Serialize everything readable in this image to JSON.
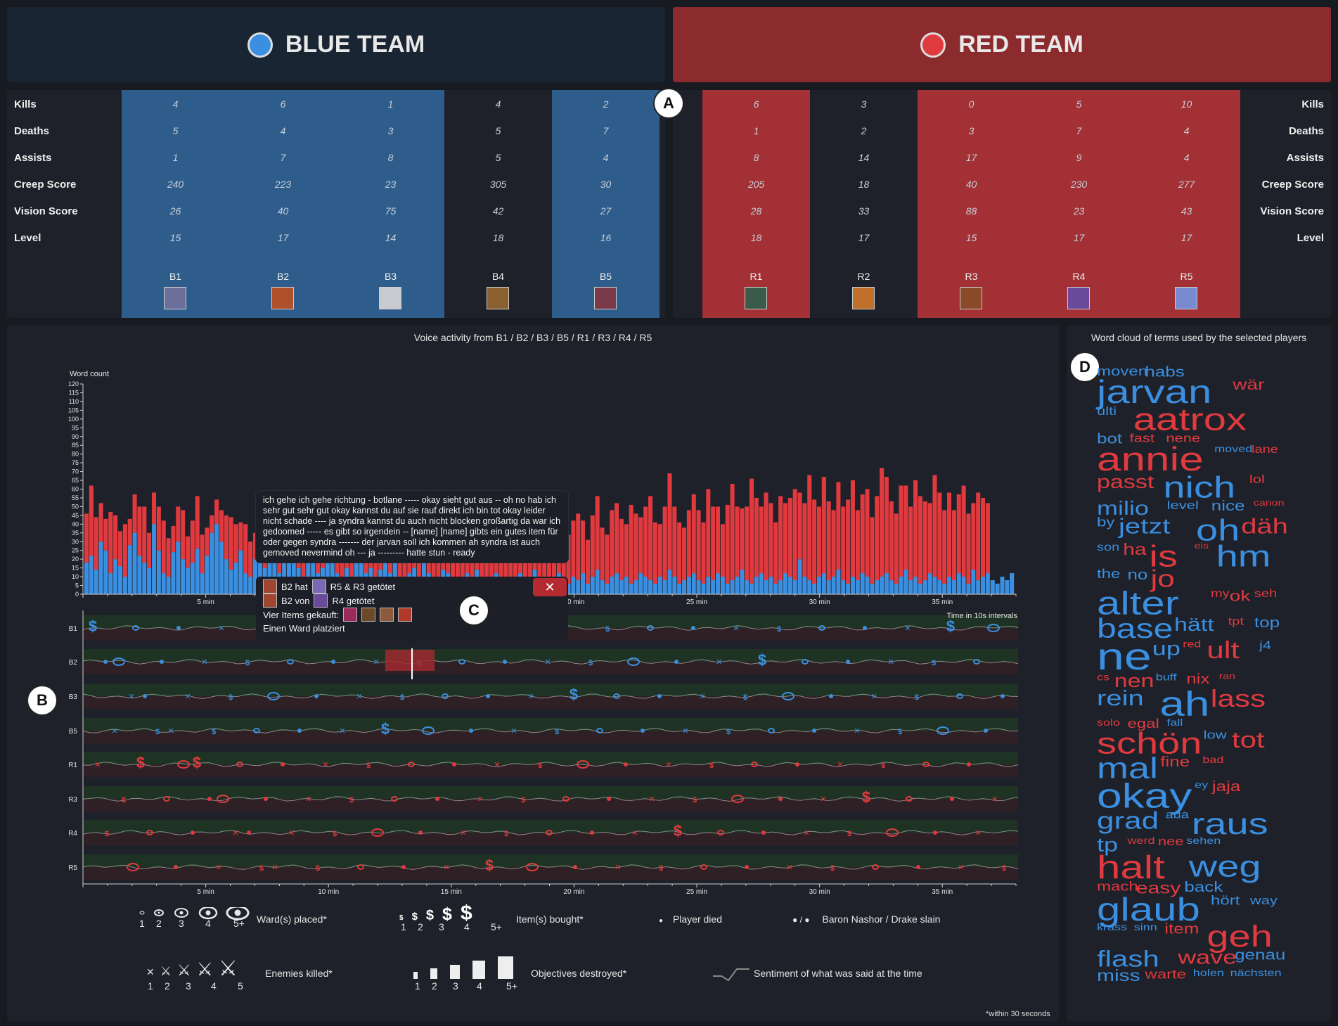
{
  "teams": {
    "blue": {
      "name": "BLUE TEAM",
      "color": "#3b8fe0"
    },
    "red": {
      "name": "RED TEAM",
      "color": "#e03a3f"
    }
  },
  "stat_labels": [
    "Kills",
    "Deaths",
    "Assists",
    "Creep Score",
    "Vision Score",
    "Level"
  ],
  "blue_players": [
    {
      "name": "B1",
      "selected": true,
      "stats": [
        "4",
        "5",
        "1",
        "240",
        "26",
        "15"
      ]
    },
    {
      "name": "B2",
      "selected": true,
      "stats": [
        "6",
        "4",
        "7",
        "223",
        "40",
        "17"
      ]
    },
    {
      "name": "B3",
      "selected": true,
      "stats": [
        "1",
        "3",
        "8",
        "23",
        "75",
        "14"
      ]
    },
    {
      "name": "B4",
      "selected": false,
      "stats": [
        "4",
        "5",
        "5",
        "305",
        "42",
        "18"
      ]
    },
    {
      "name": "B5",
      "selected": true,
      "stats": [
        "2",
        "7",
        "4",
        "30",
        "27",
        "16"
      ]
    }
  ],
  "red_players": [
    {
      "name": "R1",
      "selected": true,
      "stats": [
        "6",
        "1",
        "8",
        "205",
        "28",
        "18"
      ]
    },
    {
      "name": "R2",
      "selected": false,
      "stats": [
        "3",
        "2",
        "14",
        "18",
        "33",
        "17"
      ]
    },
    {
      "name": "R3",
      "selected": true,
      "stats": [
        "0",
        "3",
        "17",
        "40",
        "88",
        "15"
      ]
    },
    {
      "name": "R4",
      "selected": true,
      "stats": [
        "5",
        "7",
        "9",
        "230",
        "23",
        "17"
      ]
    },
    {
      "name": "R5",
      "selected": true,
      "stats": [
        "10",
        "4",
        "4",
        "277",
        "43",
        "17"
      ]
    }
  ],
  "markers": {
    "a": "A",
    "b": "B",
    "c": "C",
    "d": "D"
  },
  "voice": {
    "title": "Voice activity from B1 / B2 / B3 / B5 / R1 / R3 / R4 / R5",
    "ylabel": "Word count",
    "interval_label": "Time in 10s intervals",
    "x_ticks": [
      "5 min",
      "10 min",
      "15 min",
      "20 min",
      "25 min",
      "30 min",
      "35 min"
    ]
  },
  "chart_data": {
    "type": "bar",
    "title": "Voice activity from B1 / B2 / B3 / B5 / R1 / R3 / R4 / R5",
    "ylabel": "Word count",
    "xlabel": "Time in 10s intervals",
    "ylim": [
      0,
      120
    ],
    "y_ticks": [
      0,
      5,
      10,
      15,
      20,
      25,
      30,
      35,
      40,
      45,
      50,
      55,
      60,
      65,
      70,
      75,
      80,
      85,
      90,
      95,
      100,
      105,
      110,
      115,
      120
    ],
    "x_ticks": [
      "5 min",
      "10 min",
      "15 min",
      "20 min",
      "25 min",
      "30 min",
      "35 min"
    ],
    "series": [
      {
        "name": "blue",
        "values": [
          18,
          22,
          14,
          30,
          25,
          12,
          20,
          16,
          10,
          28,
          35,
          22,
          18,
          15,
          40,
          25,
          12,
          10,
          24,
          30,
          20,
          15,
          18,
          26,
          12,
          22,
          35,
          40,
          30,
          20,
          14,
          18,
          25,
          12,
          10,
          20,
          28,
          15,
          22,
          18,
          12,
          30,
          25,
          20,
          15,
          10,
          18,
          22,
          12,
          15,
          24,
          20,
          12,
          8,
          15,
          10,
          18,
          22,
          12,
          15,
          10,
          14,
          18,
          12,
          20,
          10,
          8,
          12,
          15,
          10,
          18,
          12,
          8,
          10,
          14,
          12,
          6,
          10,
          8,
          12,
          10,
          14,
          8,
          6,
          10,
          12,
          8,
          10,
          6,
          8,
          12,
          10,
          8,
          14,
          10,
          6,
          8,
          10,
          12,
          8,
          6,
          10,
          8,
          12,
          6,
          10,
          14,
          8,
          6,
          10,
          12,
          8,
          10,
          6,
          8,
          12,
          10,
          8,
          6,
          10,
          8,
          14,
          10,
          6,
          8,
          10,
          12,
          8,
          6,
          10,
          8,
          12,
          10,
          6,
          8,
          10,
          14,
          8,
          6,
          10,
          12,
          8,
          10,
          6,
          8,
          12,
          10,
          8,
          20,
          10,
          8,
          6,
          10,
          12,
          8,
          10,
          14,
          8,
          6,
          10,
          8,
          12,
          10,
          6,
          8,
          10,
          12,
          8,
          6,
          10,
          14,
          8,
          10,
          6,
          8,
          12,
          10,
          8,
          6,
          10,
          8,
          12,
          10,
          6,
          14,
          8,
          10,
          12,
          8,
          6,
          10,
          8,
          12
        ]
      },
      {
        "name": "red",
        "values": [
          28,
          40,
          30,
          22,
          18,
          35,
          25,
          20,
          30,
          15,
          22,
          28,
          32,
          20,
          18,
          25,
          30,
          22,
          15,
          20,
          28,
          18,
          24,
          30,
          22,
          16,
          10,
          14,
          18,
          25,
          30,
          22,
          16,
          28,
          20,
          15,
          22,
          18,
          26,
          14,
          20,
          25,
          18,
          12,
          30,
          22,
          16,
          20,
          25,
          18,
          12,
          20,
          28,
          16,
          22,
          18,
          35,
          25,
          15,
          20,
          40,
          28,
          22,
          30,
          18,
          25,
          32,
          20,
          15,
          28,
          22,
          30,
          35,
          25,
          20,
          30,
          40,
          28,
          22,
          35,
          45,
          30,
          25,
          38,
          28,
          22,
          30,
          40,
          35,
          28,
          25,
          30,
          38,
          42,
          30,
          28,
          35,
          40,
          30,
          25,
          28,
          32,
          38,
          30,
          25,
          35,
          42,
          30,
          28,
          38,
          40,
          35,
          30,
          45,
          38,
          32,
          40,
          48,
          35,
          30,
          42,
          55,
          40,
          35,
          30,
          38,
          45,
          40,
          35,
          50,
          42,
          38,
          30,
          45,
          55,
          40,
          35,
          42,
          60,
          45,
          38,
          50,
          42,
          35,
          48,
          40,
          45,
          52,
          38,
          42,
          60,
          48,
          40,
          55,
          45,
          38,
          50,
          42,
          48,
          55,
          40,
          45,
          50,
          38,
          48,
          62,
          55,
          45,
          40,
          52,
          48,
          42,
          55,
          50,
          45,
          40,
          58,
          50,
          42,
          48,
          40,
          45,
          52,
          40,
          38,
          50,
          45,
          40
        ]
      }
    ]
  },
  "timeline": {
    "rows": [
      {
        "name": "B1",
        "team": "blue"
      },
      {
        "name": "B2",
        "team": "blue"
      },
      {
        "name": "B3",
        "team": "blue"
      },
      {
        "name": "B5",
        "team": "blue"
      },
      {
        "name": "R1",
        "team": "red"
      },
      {
        "name": "R3",
        "team": "red"
      },
      {
        "name": "R4",
        "team": "red"
      },
      {
        "name": "R5",
        "team": "red"
      }
    ],
    "x_ticks": [
      "5 min",
      "10 min",
      "15 min",
      "20 min",
      "25 min",
      "30 min",
      "35 min"
    ]
  },
  "tooltip": {
    "transcript": "ich gehe ich gehe richtung - botlane ----- okay sieht gut aus -- oh no hab ich sehr gut sehr gut okay kannst du auf sie rauf direkt ich bin tot okay leider nicht schade ---- ja syndra kannst du auch nicht blocken großartig da war ich gedoomed ----- es gibt so irgendein -- [name] [name] gibts ein gutes item für oder gegen syndra ------- der jarvan soll ich kommen ah syndra ist auch gemoved nevermind oh --- ja --------- hatte stun - ready",
    "event1_a": "B2 hat",
    "event1_b": "R5 & R3 getötet",
    "event2_a": "B2 von",
    "event2_b": "R4 getötet",
    "event3": "Vier Items gekauft:",
    "event4": "Einen Ward platziert",
    "close": "✕"
  },
  "legend": {
    "wards": "Ward(s) placed*",
    "items": "Item(s) bought*",
    "died": "Player died",
    "baron": "Baron Nashor / Drake slain",
    "kills": "Enemies killed*",
    "objectives": "Objectives destroyed*",
    "sentiment": "Sentiment of what was said at the time",
    "counts": [
      "1",
      "2",
      "3",
      "4",
      "5+"
    ],
    "kill_counts": [
      "1",
      "2",
      "3",
      "4",
      "5"
    ],
    "footnote": "*within 30 seconds"
  },
  "wordcloud": {
    "title": "Word cloud of terms used by the selected players",
    "words": [
      {
        "t": "moven",
        "c": "b",
        "s": 24
      },
      {
        "t": "habs",
        "c": "b",
        "s": 26
      },
      {
        "t": "jarvan",
        "c": "b",
        "s": 60
      },
      {
        "t": "wär",
        "c": "r",
        "s": 28
      },
      {
        "t": "ulti",
        "c": "b",
        "s": 22
      },
      {
        "t": "aatrox",
        "c": "r",
        "s": 58
      },
      {
        "t": "bot",
        "c": "b",
        "s": 26
      },
      {
        "t": "fast",
        "c": "r",
        "s": 22
      },
      {
        "t": "nene",
        "c": "r",
        "s": 22
      },
      {
        "t": "annie",
        "c": "r",
        "s": 62
      },
      {
        "t": "moved",
        "c": "b",
        "s": 18
      },
      {
        "t": "lane",
        "c": "r",
        "s": 20
      },
      {
        "t": "passt",
        "c": "r",
        "s": 34
      },
      {
        "t": "nich",
        "c": "b",
        "s": 56
      },
      {
        "t": "lol",
        "c": "r",
        "s": 22
      },
      {
        "t": "milio",
        "c": "b",
        "s": 36
      },
      {
        "t": "level",
        "c": "b",
        "s": 22
      },
      {
        "t": "nice",
        "c": "b",
        "s": 26
      },
      {
        "t": "canon",
        "c": "r",
        "s": 16
      },
      {
        "t": "by",
        "c": "b",
        "s": 24
      },
      {
        "t": "jetzt",
        "c": "b",
        "s": 40
      },
      {
        "t": "oh",
        "c": "b",
        "s": 56
      },
      {
        "t": "däh",
        "c": "r",
        "s": 40
      },
      {
        "t": "son",
        "c": "b",
        "s": 20
      },
      {
        "t": "ha",
        "c": "r",
        "s": 30
      },
      {
        "t": "is",
        "c": "r",
        "s": 56
      },
      {
        "t": "eis",
        "c": "r",
        "s": 16
      },
      {
        "t": "hm",
        "c": "b",
        "s": 56
      },
      {
        "t": "the",
        "c": "b",
        "s": 24
      },
      {
        "t": "no",
        "c": "b",
        "s": 26
      },
      {
        "t": "jo",
        "c": "r",
        "s": 44
      },
      {
        "t": "alter",
        "c": "b",
        "s": 60
      },
      {
        "t": "my",
        "c": "r",
        "s": 20
      },
      {
        "t": "ok",
        "c": "r",
        "s": 28
      },
      {
        "t": "seh",
        "c": "r",
        "s": 20
      },
      {
        "t": "base",
        "c": "b",
        "s": 50
      },
      {
        "t": "hätt",
        "c": "b",
        "s": 34
      },
      {
        "t": "tpt",
        "c": "r",
        "s": 20
      },
      {
        "t": "top",
        "c": "b",
        "s": 26
      },
      {
        "t": "ne",
        "c": "b",
        "s": 70
      },
      {
        "t": "up",
        "c": "b",
        "s": 36
      },
      {
        "t": "red",
        "c": "r",
        "s": 18
      },
      {
        "t": "ult",
        "c": "r",
        "s": 44
      },
      {
        "t": "j4",
        "c": "b",
        "s": 22
      },
      {
        "t": "cs",
        "c": "r",
        "s": 18
      },
      {
        "t": "nen",
        "c": "r",
        "s": 34
      },
      {
        "t": "buff",
        "c": "b",
        "s": 18
      },
      {
        "t": "nix",
        "c": "r",
        "s": 26
      },
      {
        "t": "ran",
        "c": "r",
        "s": 16
      },
      {
        "t": "rein",
        "c": "b",
        "s": 40
      },
      {
        "t": "ah",
        "c": "b",
        "s": 64
      },
      {
        "t": "lass",
        "c": "r",
        "s": 44
      },
      {
        "t": "solo",
        "c": "r",
        "s": 18
      },
      {
        "t": "egal",
        "c": "r",
        "s": 24
      },
      {
        "t": "fall",
        "c": "b",
        "s": 18
      },
      {
        "t": "schön",
        "c": "r",
        "s": 56
      },
      {
        "t": "low",
        "c": "b",
        "s": 22
      },
      {
        "t": "tot",
        "c": "r",
        "s": 42
      },
      {
        "t": "mal",
        "c": "b",
        "s": 54
      },
      {
        "t": "fine",
        "c": "r",
        "s": 26
      },
      {
        "t": "bad",
        "c": "r",
        "s": 18
      },
      {
        "t": "okay",
        "c": "b",
        "s": 64
      },
      {
        "t": "ey",
        "c": "b",
        "s": 18
      },
      {
        "t": "jaja",
        "c": "r",
        "s": 26
      },
      {
        "t": "grad",
        "c": "b",
        "s": 44
      },
      {
        "t": "aua",
        "c": "b",
        "s": 20
      },
      {
        "t": "raus",
        "c": "b",
        "s": 56
      },
      {
        "t": "tp",
        "c": "b",
        "s": 36
      },
      {
        "t": "werd",
        "c": "r",
        "s": 18
      },
      {
        "t": "nee",
        "c": "r",
        "s": 22
      },
      {
        "t": "sehen",
        "c": "b",
        "s": 18
      },
      {
        "t": "halt",
        "c": "r",
        "s": 60
      },
      {
        "t": "weg",
        "c": "b",
        "s": 56
      },
      {
        "t": "mach",
        "c": "r",
        "s": 24
      },
      {
        "t": "easy",
        "c": "r",
        "s": 30
      },
      {
        "t": "back",
        "c": "b",
        "s": 26
      },
      {
        "t": "glaub",
        "c": "b",
        "s": 60
      },
      {
        "t": "hört",
        "c": "b",
        "s": 24
      },
      {
        "t": "way",
        "c": "b",
        "s": 22
      },
      {
        "t": "krass",
        "c": "b",
        "s": 18
      },
      {
        "t": "sinn",
        "c": "b",
        "s": 18
      },
      {
        "t": "item",
        "c": "r",
        "s": 26
      },
      {
        "t": "geh",
        "c": "r",
        "s": 56
      },
      {
        "t": "flash",
        "c": "b",
        "s": 42
      },
      {
        "t": "wave",
        "c": "r",
        "s": 36
      },
      {
        "t": "genau",
        "c": "b",
        "s": 26
      },
      {
        "t": "miss",
        "c": "b",
        "s": 30
      },
      {
        "t": "warte",
        "c": "r",
        "s": 24
      },
      {
        "t": "holen",
        "c": "b",
        "s": 18
      },
      {
        "t": "nächsten",
        "c": "b",
        "s": 18
      }
    ]
  }
}
